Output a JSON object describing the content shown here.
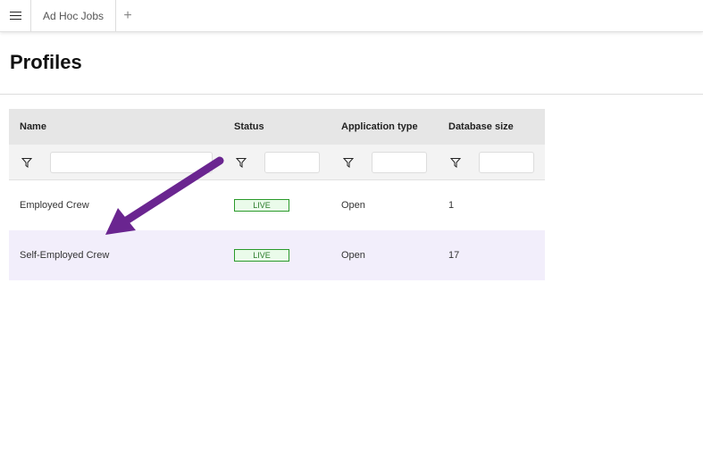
{
  "tabs": {
    "active": "Ad Hoc Jobs",
    "add": "+"
  },
  "page_title": "Profiles",
  "table": {
    "columns": [
      "Name",
      "Status",
      "Application type",
      "Database size"
    ],
    "filters": [
      "",
      "",
      "",
      ""
    ],
    "rows": [
      {
        "name": "Employed Crew",
        "status": "LIVE",
        "app_type": "Open",
        "db_size": "1"
      },
      {
        "name": "Self-Employed Crew",
        "status": "LIVE",
        "app_type": "Open",
        "db_size": "17"
      }
    ]
  },
  "colors": {
    "arrow": "#6a2590",
    "selected_row": "#f2eefb",
    "live": "#2a9a2a"
  }
}
